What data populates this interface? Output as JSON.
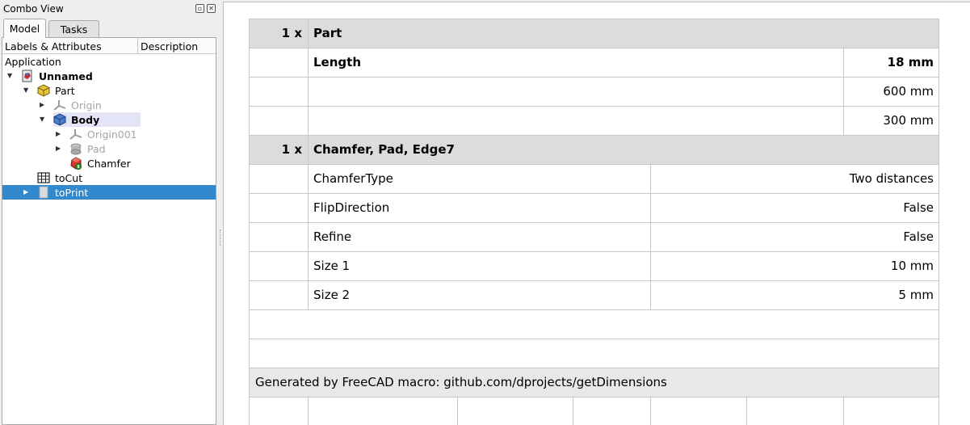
{
  "combo": {
    "title": "Combo View",
    "tabs": [
      {
        "label": "Model"
      },
      {
        "label": "Tasks"
      }
    ],
    "columns": {
      "labels": "Labels & Attributes",
      "description": "Description"
    },
    "tree": {
      "application": "Application",
      "unnamed": "Unnamed",
      "part": "Part",
      "origin": "Origin",
      "body": "Body",
      "origin001": "Origin001",
      "pad": "Pad",
      "chamfer": "Chamfer",
      "tocut": "toCut",
      "toprint": "toPrint"
    }
  },
  "report": {
    "part_header": {
      "qty": "1 x",
      "name": "Part"
    },
    "length_row": {
      "label": "Length",
      "value": "18 mm"
    },
    "dim_rows": [
      {
        "value": "600 mm"
      },
      {
        "value": "300 mm"
      }
    ],
    "chamfer_header": {
      "qty": "1 x",
      "name": "Chamfer, Pad, Edge7"
    },
    "properties": [
      {
        "name": "ChamferType",
        "value": "Two distances"
      },
      {
        "name": "FlipDirection",
        "value": "False"
      },
      {
        "name": "Refine",
        "value": "False"
      },
      {
        "name": "Size 1",
        "value": "10 mm"
      },
      {
        "name": "Size 2",
        "value": "5 mm"
      }
    ],
    "footer": "Generated by FreeCAD macro: github.com/dprojects/getDimensions"
  },
  "colors": {
    "selection": "#3389cd",
    "header_bg": "#dcdcdc",
    "body_highlight": "#e4e4f8"
  }
}
